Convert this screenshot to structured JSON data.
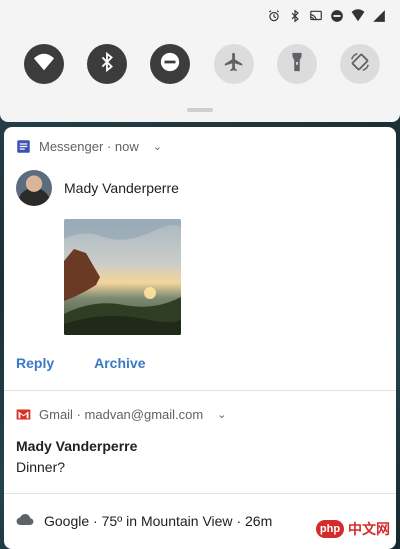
{
  "status_bar": {
    "icons": [
      "alarm-icon",
      "bluetooth-icon",
      "cast-icon",
      "do-not-disturb-icon",
      "signal-icon",
      "battery-icon"
    ]
  },
  "quick_settings": {
    "tiles": [
      {
        "name": "wifi",
        "icon": "wifi-icon",
        "state": "on"
      },
      {
        "name": "bluetooth",
        "icon": "bluetooth-icon",
        "state": "on"
      },
      {
        "name": "do-not-disturb",
        "icon": "do-not-disturb-icon",
        "state": "on"
      },
      {
        "name": "airplane-mode",
        "icon": "airplane-icon",
        "state": "off"
      },
      {
        "name": "flashlight",
        "icon": "flashlight-icon",
        "state": "off"
      },
      {
        "name": "auto-rotate",
        "icon": "rotate-icon",
        "state": "off"
      }
    ]
  },
  "messenger": {
    "app_name": "Messenger",
    "time": "now",
    "sender": "Mady Vanderperre",
    "actions": [
      "Reply",
      "Archive"
    ],
    "accent": "#3b78c6"
  },
  "gmail": {
    "app_name": "Gmail",
    "account": "madvan@gmail.com",
    "sender": "Mady Vanderperre",
    "subject": "Dinner?"
  },
  "weather": {
    "app_name": "Google",
    "summary": "75º in Mountain View",
    "time": "26m"
  },
  "watermark": {
    "logo": "php",
    "text": "中文网"
  }
}
